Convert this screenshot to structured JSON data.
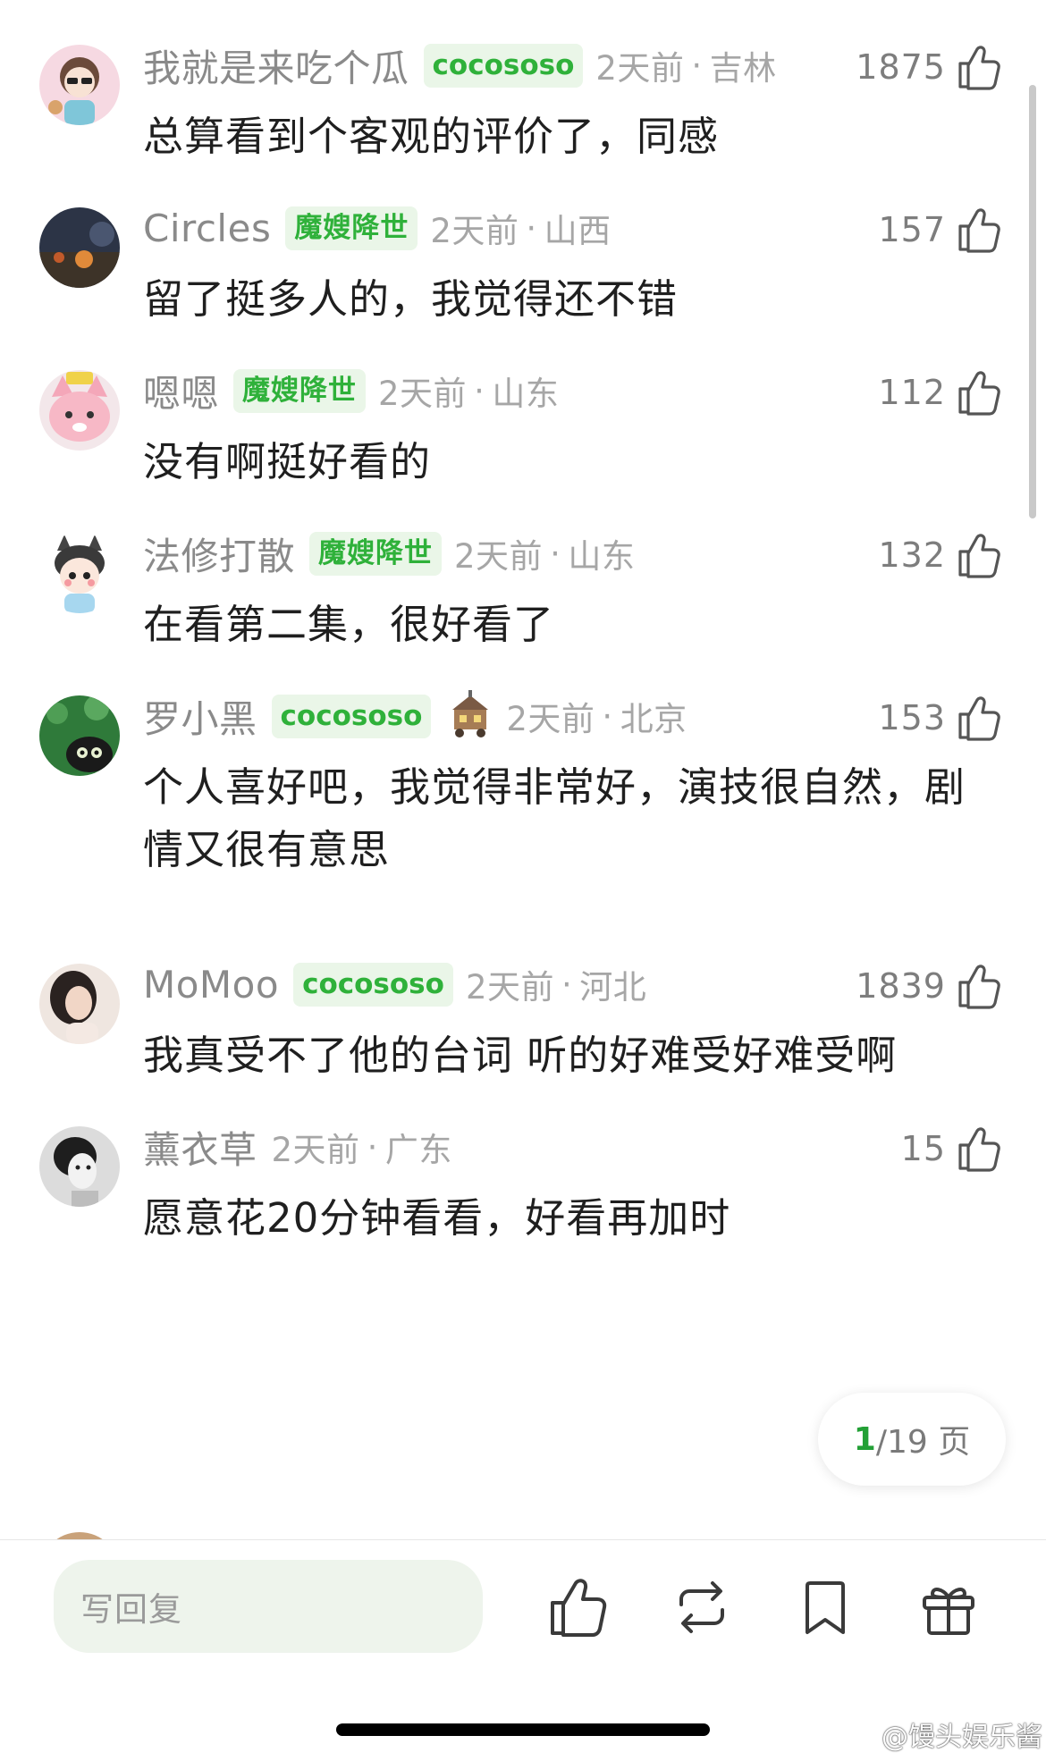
{
  "comments": [
    {
      "username": "我就是来吃个瓜",
      "badge": "cocososo",
      "time": "2天前",
      "location": "吉林",
      "likes": "1875",
      "text": "总算看到个客观的评价了，同感",
      "avatar_icon": "cartoon-girl-avatar"
    },
    {
      "username": "Circles",
      "badge": "魔嫂降世",
      "time": "2天前",
      "location": "山西",
      "likes": "157",
      "text": "留了挺多人的，我觉得还不错",
      "avatar_icon": "night-scene-avatar"
    },
    {
      "username": "嗯嗯",
      "badge": "魔嫂降世",
      "time": "2天前",
      "location": "山东",
      "likes": "112",
      "text": "没有啊挺好看的",
      "avatar_icon": "pink-fox-avatar"
    },
    {
      "username": "法修打散",
      "badge": "魔嫂降世",
      "time": "2天前",
      "location": "山东",
      "likes": "132",
      "text": "在看第二集，很好看了",
      "avatar_icon": "anime-boy-avatar"
    },
    {
      "username": "罗小黑",
      "badge": "cocososo",
      "time": "2天前",
      "location": "北京",
      "likes": "153",
      "text": "个人喜好吧，我觉得非常好，演技很自然，剧情又很有意思",
      "avatar_icon": "black-cat-avatar",
      "decoration_icon": "house-cart-icon"
    },
    {
      "username": "MoMoo",
      "badge": "cocososo",
      "time": "2天前",
      "location": "河北",
      "likes": "1839",
      "text": "我真受不了他的台词 听的好难受好难受啊",
      "avatar_icon": "portrait-woman-avatar"
    },
    {
      "username": "薰衣草",
      "badge": "",
      "time": "2天前",
      "location": "广东",
      "likes": "15",
      "text": "愿意花20分钟看看，好看再加时",
      "avatar_icon": "bw-portrait-avatar"
    }
  ],
  "meta_separator": "·",
  "pager": {
    "current": "1",
    "total_text": "/19 页"
  },
  "bottom_bar": {
    "reply_placeholder": "写回复",
    "like_icon": "thumbs-up-icon",
    "repost_icon": "repost-icon",
    "bookmark_icon": "bookmark-icon",
    "gift_icon": "gift-icon"
  },
  "watermark": "@馒头娱乐酱",
  "colors": {
    "badge_green": "#2fb13a",
    "badge_bg": "#eaf6e8",
    "reply_bg": "#eef4ec"
  }
}
